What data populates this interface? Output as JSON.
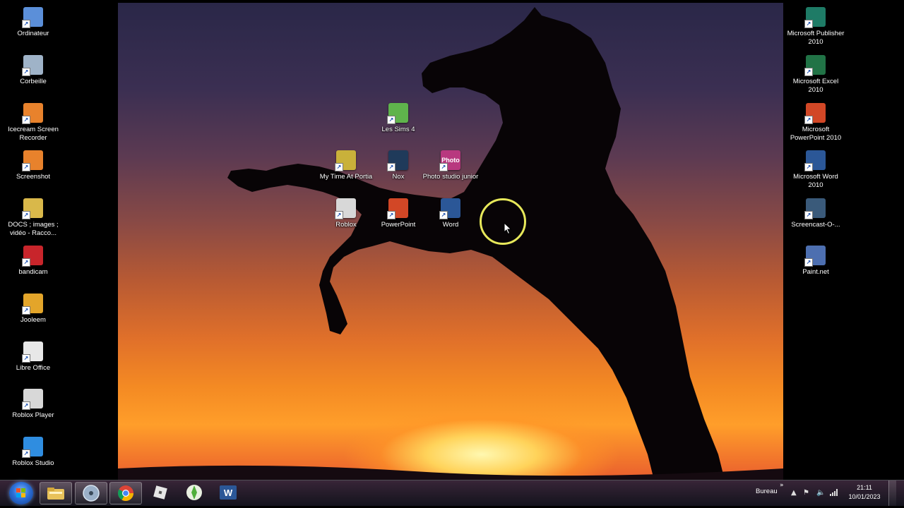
{
  "desktop_left": [
    {
      "label": "Ordinateur",
      "icon": "computer-icon",
      "color": "#5b8fd9"
    },
    {
      "label": "Corbeille",
      "icon": "recycle-bin-icon",
      "color": "#9fb3c8"
    },
    {
      "label": "Icecream Screen Recorder",
      "icon": "icecream-recorder-icon",
      "color": "#e8822c"
    },
    {
      "label": "Screenshot",
      "icon": "screenshot-icon",
      "color": "#e8822c"
    },
    {
      "label": "DOCS ; images ; vidéo - Racco...",
      "icon": "folder-icon",
      "color": "#d9b84a"
    },
    {
      "label": "bandicam",
      "icon": "bandicam-icon",
      "color": "#c8252b"
    },
    {
      "label": "Jooleem",
      "icon": "jooleem-icon",
      "color": "#e3a52a"
    },
    {
      "label": "Libre Office",
      "icon": "libreoffice-icon",
      "color": "#e8e8e8"
    },
    {
      "label": "Roblox Player",
      "icon": "roblox-icon",
      "color": "#d8d8d8"
    },
    {
      "label": "Roblox Studio",
      "icon": "roblox-studio-icon",
      "color": "#2f8de0"
    }
  ],
  "desktop_middle": [
    {
      "label": "Les Sims 4",
      "icon": "sims-icon",
      "color": "#5fb34c"
    },
    {
      "label": "My Time At Portia",
      "icon": "portia-icon",
      "color": "#c9b13a"
    },
    {
      "label": "Nox",
      "icon": "nox-icon",
      "color": "#1f3a5a"
    },
    {
      "label": "Photo studio junior",
      "icon": "photo-studio-icon",
      "color": "#b8387f"
    },
    {
      "label": "Roblox",
      "icon": "roblox-icon",
      "color": "#d8d8d8"
    },
    {
      "label": "PowerPoint",
      "icon": "powerpoint-icon",
      "color": "#d24726"
    },
    {
      "label": "Word",
      "icon": "word-icon",
      "color": "#2b5797"
    }
  ],
  "photo_studio_glyph": "Photo",
  "desktop_right": [
    {
      "label": "Microsoft Publisher 2010",
      "icon": "publisher-icon",
      "color": "#1e7b66"
    },
    {
      "label": "Microsoft Excel 2010",
      "icon": "excel-icon",
      "color": "#217346"
    },
    {
      "label": "Microsoft PowerPoint 2010",
      "icon": "powerpoint-icon",
      "color": "#d24726"
    },
    {
      "label": "Microsoft Word 2010",
      "icon": "word-icon",
      "color": "#2b5797"
    },
    {
      "label": "Screencast-O-...",
      "icon": "screencast-icon",
      "color": "#3a5a7a"
    },
    {
      "label": "Paint.net",
      "icon": "paintnet-icon",
      "color": "#4d6fb0"
    }
  ],
  "taskbar": {
    "pinned": [
      {
        "name": "explorer",
        "icon": "folder-icon"
      },
      {
        "name": "media-player",
        "icon": "media-player-icon"
      },
      {
        "name": "chrome",
        "icon": "chrome-icon"
      },
      {
        "name": "roblox",
        "icon": "roblox-icon"
      },
      {
        "name": "sims",
        "icon": "sims-icon"
      },
      {
        "name": "word",
        "icon": "word-icon"
      }
    ],
    "desktop_label": "Bureau",
    "chevron": "»",
    "clock_time": "21:11",
    "clock_date": "10/01/2023"
  },
  "accent_cursor_ring": "#e7e85a"
}
